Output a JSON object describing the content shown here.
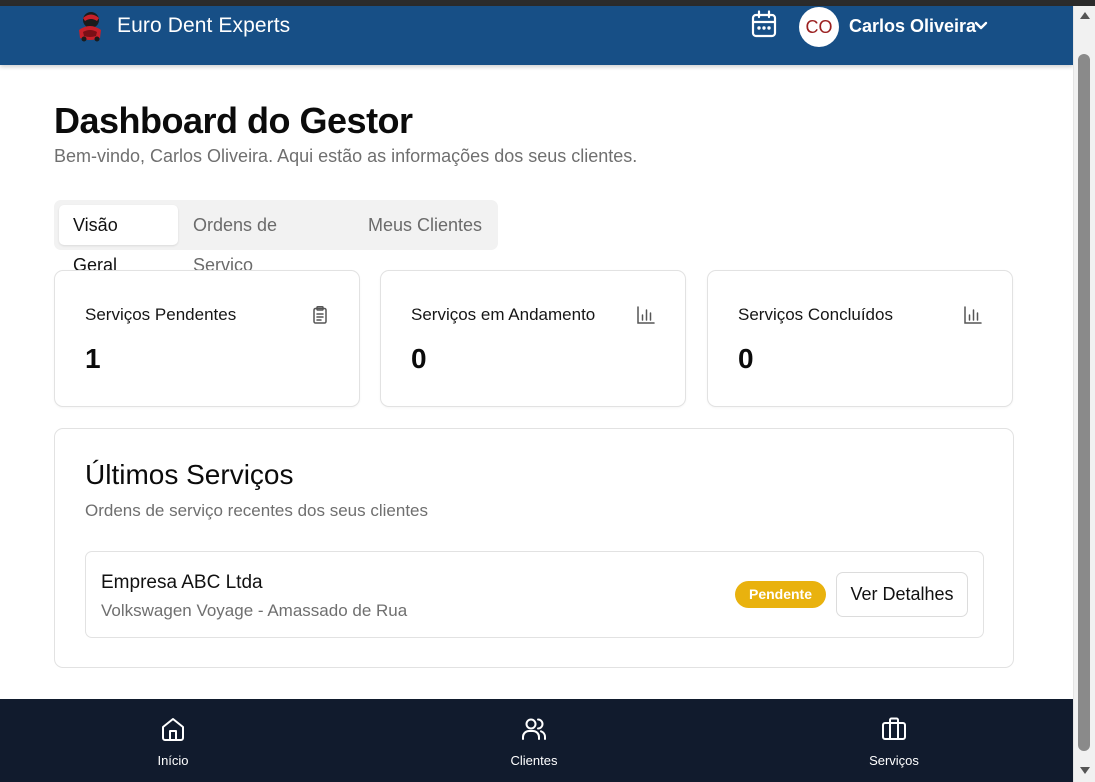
{
  "header": {
    "brand": "Euro Dent Experts",
    "logo_icon": "car-dent-logo-icon",
    "calendar_icon": "calendar-icon",
    "avatar_initials": "CO",
    "user_name": "Carlos Oliveira",
    "menu_icon": "chevron-down-icon",
    "colors": {
      "header_bg": "#174f86",
      "avatar_text": "#9b2020"
    }
  },
  "page": {
    "title": "Dashboard do Gestor",
    "subtitle": "Bem-vindo, Carlos Oliveira. Aqui estão as informações dos seus clientes."
  },
  "tabs": [
    {
      "label": "Visão Geral",
      "active": true
    },
    {
      "label": "Ordens de Serviço",
      "active": false
    },
    {
      "label": "Meus Clientes",
      "active": false
    }
  ],
  "stats": [
    {
      "label": "Serviços Pendentes",
      "value": "1",
      "icon": "clipboard-icon"
    },
    {
      "label": "Serviços em Andamento",
      "value": "0",
      "icon": "bar-chart-icon"
    },
    {
      "label": "Serviços Concluídos",
      "value": "0",
      "icon": "bar-chart-icon"
    }
  ],
  "recent": {
    "title": "Últimos Serviços",
    "subtitle": "Ordens de serviço recentes dos seus clientes",
    "items": [
      {
        "company": "Empresa ABC Ltda",
        "detail": "Volkswagen Voyage - Amassado de Rua",
        "status": "Pendente",
        "status_color": "#e9b20e",
        "action": "Ver Detalhes"
      }
    ]
  },
  "bottom_nav": [
    {
      "label": "Início",
      "icon": "home-icon"
    },
    {
      "label": "Clientes",
      "icon": "users-icon"
    },
    {
      "label": "Serviços",
      "icon": "briefcase-icon"
    }
  ],
  "colors": {
    "bottom_nav_bg": "#111b2d",
    "accent": "#174f86"
  }
}
